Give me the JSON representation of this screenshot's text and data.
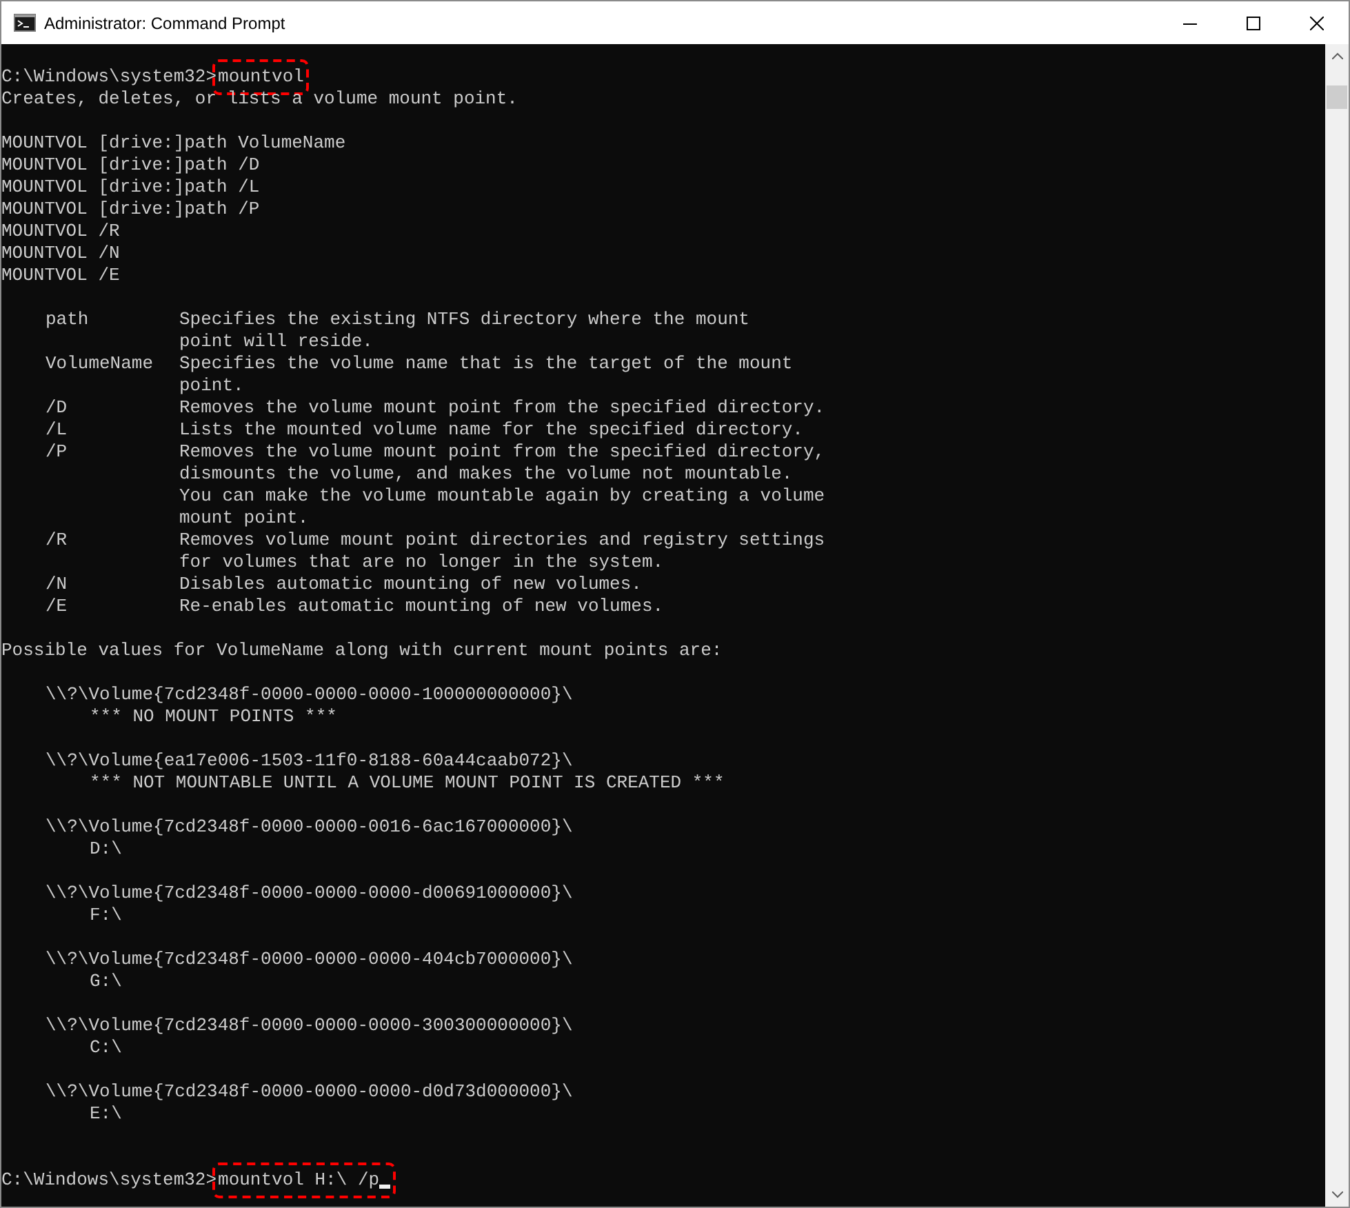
{
  "window": {
    "title": "Administrator: Command Prompt"
  },
  "console": {
    "blocks": [
      [
        {
          "kind": "prompt",
          "prompt": "C:\\Windows\\system32>",
          "command": "mountvol",
          "highlighted": true,
          "cursor": false
        },
        {
          "kind": "text",
          "text": "Creates, deletes, or lists a volume mount point."
        }
      ],
      [
        {
          "kind": "text",
          "text": "MOUNTVOL [drive:]path VolumeName"
        },
        {
          "kind": "text",
          "text": "MOUNTVOL [drive:]path /D"
        },
        {
          "kind": "text",
          "text": "MOUNTVOL [drive:]path /L"
        },
        {
          "kind": "text",
          "text": "MOUNTVOL [drive:]path /P"
        },
        {
          "kind": "text",
          "text": "MOUNTVOL /R"
        },
        {
          "kind": "text",
          "text": "MOUNTVOL /N"
        },
        {
          "kind": "text",
          "text": "MOUNTVOL /E"
        }
      ],
      [
        {
          "kind": "option",
          "option": "path",
          "lines": [
            "Specifies the existing NTFS directory where the mount",
            "point will reside."
          ]
        },
        {
          "kind": "option",
          "option": "VolumeName",
          "lines": [
            "Specifies the volume name that is the target of the mount",
            "point."
          ]
        },
        {
          "kind": "option",
          "option": "/D",
          "lines": [
            "Removes the volume mount point from the specified directory."
          ]
        },
        {
          "kind": "option",
          "option": "/L",
          "lines": [
            "Lists the mounted volume name for the specified directory."
          ]
        },
        {
          "kind": "option",
          "option": "/P",
          "lines": [
            "Removes the volume mount point from the specified directory,",
            "dismounts the volume, and makes the volume not mountable.",
            "You can make the volume mountable again by creating a volume",
            "mount point."
          ]
        },
        {
          "kind": "option",
          "option": "/R",
          "lines": [
            "Removes volume mount point directories and registry settings",
            "for volumes that are no longer in the system."
          ]
        },
        {
          "kind": "option",
          "option": "/N",
          "lines": [
            "Disables automatic mounting of new volumes."
          ]
        },
        {
          "kind": "option",
          "option": "/E",
          "lines": [
            "Re-enables automatic mounting of new volumes."
          ]
        }
      ],
      [
        {
          "kind": "text",
          "text": "Possible values for VolumeName along with current mount points are:"
        }
      ],
      [
        {
          "kind": "volume",
          "name": "\\\\?\\Volume{7cd2348f-0000-0000-0000-100000000000}\\",
          "mount": "*** NO MOUNT POINTS ***"
        }
      ],
      [
        {
          "kind": "volume",
          "name": "\\\\?\\Volume{ea17e006-1503-11f0-8188-60a44caab072}\\",
          "mount": "*** NOT MOUNTABLE UNTIL A VOLUME MOUNT POINT IS CREATED ***"
        }
      ],
      [
        {
          "kind": "volume",
          "name": "\\\\?\\Volume{7cd2348f-0000-0000-0016-6ac167000000}\\",
          "mount": "D:\\"
        }
      ],
      [
        {
          "kind": "volume",
          "name": "\\\\?\\Volume{7cd2348f-0000-0000-0000-d00691000000}\\",
          "mount": "F:\\"
        }
      ],
      [
        {
          "kind": "volume",
          "name": "\\\\?\\Volume{7cd2348f-0000-0000-0000-404cb7000000}\\",
          "mount": "G:\\"
        }
      ],
      [
        {
          "kind": "volume",
          "name": "\\\\?\\Volume{7cd2348f-0000-0000-0000-300300000000}\\",
          "mount": "C:\\"
        }
      ],
      [
        {
          "kind": "volume",
          "name": "\\\\?\\Volume{7cd2348f-0000-0000-0000-d0d73d000000}\\",
          "mount": "E:\\"
        }
      ],
      [
        {
          "kind": "prompt",
          "prompt": "C:\\Windows\\system32>",
          "command": "mountvol H:\\ /p",
          "highlighted": true,
          "cursor": true
        }
      ]
    ]
  }
}
